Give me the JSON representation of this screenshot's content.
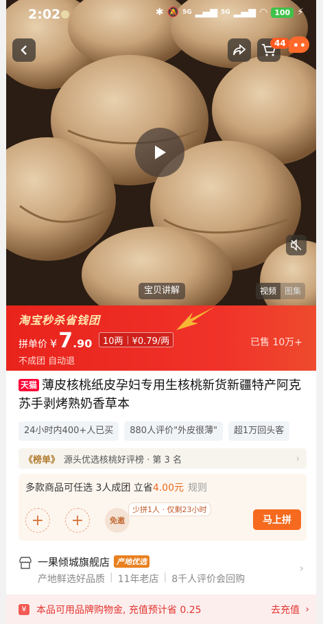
{
  "status_bar": {
    "time": "2:02",
    "network1": "5G",
    "network2": "5G",
    "battery": "100"
  },
  "header": {
    "cart_count": "44"
  },
  "media": {
    "explain_label": "宝贝讲解",
    "tabs": [
      "视频",
      "图集"
    ]
  },
  "banner": {
    "logo": "淘宝秒杀省钱团",
    "price_label": "拼单价",
    "currency": "¥",
    "price_int": "7",
    "price_dec": ".90",
    "unit_qty": "10两",
    "unit_price": "¥0.79/两",
    "sold": "已售 10万+",
    "notice": "不成团 自动退"
  },
  "product": {
    "badge": "天猫",
    "title": "薄皮核桃纸皮孕妇专用生核桃新货新疆特产阿克苏手剥烤熟奶香草本"
  },
  "tags": [
    "24小时内400+人已买",
    "880人评价\"外皮很薄\"",
    "超1万回头客"
  ],
  "rank": {
    "name": "《榜单》",
    "text": "源头优选核桃好评榜 · 第 3 名"
  },
  "group": {
    "head_prefix": "多款商品可任选 3人成团 立省",
    "amount": "4.00元",
    "rule": "规则",
    "free_label": "免邀",
    "need_text": "少拼1人 · 仅剩23小时",
    "join_label": "马上拼"
  },
  "store": {
    "name": "一果倾城旗舰店",
    "tag": "产地优选",
    "desc": [
      "产地鲜选好品质",
      "11年老店",
      "8千人评价会回购"
    ]
  },
  "bottom": {
    "coin_icon": "¥",
    "text": "本品可用品牌购物金, 充值预计省 0.25",
    "action": "去充值"
  },
  "colors": {
    "banner_red": "#e8231c",
    "accent_orange": "#f56a1e",
    "tmall_red": "#ff0036"
  }
}
